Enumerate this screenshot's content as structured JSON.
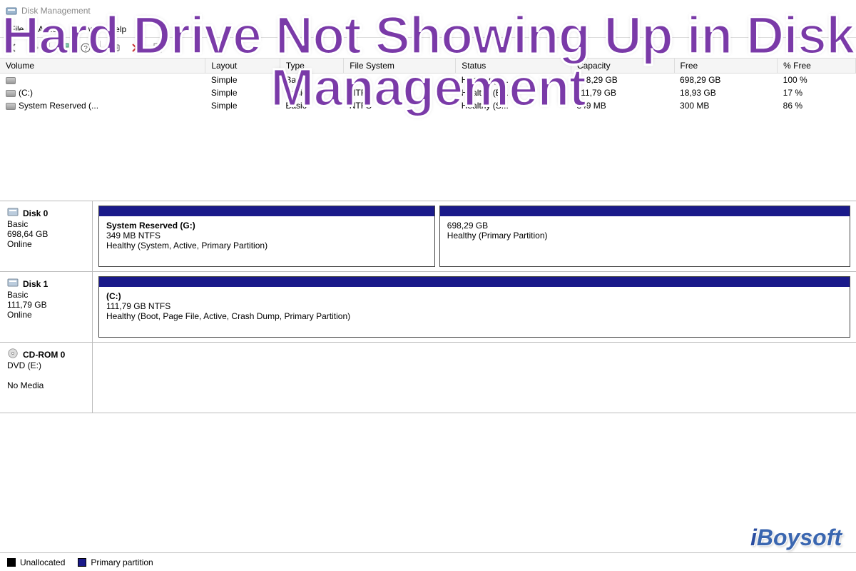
{
  "headline": "Hard Drive Not Showing Up in Disk Management",
  "watermark": "iBoysoft",
  "title": "Disk Management",
  "menu": {
    "file": "File",
    "action": "Action",
    "view": "View",
    "help": "Help"
  },
  "table": {
    "headers": {
      "volume": "Volume",
      "layout": "Layout",
      "type": "Type",
      "filesystem": "File System",
      "status": "Status",
      "capacity": "Capacity",
      "free": "Free",
      "pctfree": "% Free"
    },
    "rows": [
      {
        "volume": "",
        "layout": "Simple",
        "type": "Basic",
        "fs": "",
        "status": "Healthy (B...",
        "capacity": "698,29 GB",
        "free": "698,29 GB",
        "pct": "100 %"
      },
      {
        "volume": "(C:)",
        "layout": "Simple",
        "type": "Basic",
        "fs": "NTFS",
        "status": "Healthy (B...",
        "capacity": "111,79 GB",
        "free": "18,93 GB",
        "pct": "17 %"
      },
      {
        "volume": "System Reserved (...",
        "layout": "Simple",
        "type": "Basic",
        "fs": "NTFS",
        "status": "Healthy (S...",
        "capacity": "349 MB",
        "free": "300 MB",
        "pct": "86 %"
      }
    ]
  },
  "disks": [
    {
      "name": "Disk 0",
      "type": "Basic",
      "size": "698,64 GB",
      "status": "Online",
      "partitions": [
        {
          "title": "System Reserved  (G:)",
          "line2": "349 MB NTFS",
          "line3": "Healthy (System, Active, Primary Partition)",
          "flex": 0.45
        },
        {
          "title": "",
          "line2": "698,29 GB",
          "line3": "Healthy (Primary Partition)",
          "flex": 0.55
        }
      ]
    },
    {
      "name": "Disk 1",
      "type": "Basic",
      "size": "111,79 GB",
      "status": "Online",
      "partitions": [
        {
          "title": "(C:)",
          "line2": "111,79 GB NTFS",
          "line3": "Healthy (Boot, Page File, Active, Crash Dump, Primary Partition)",
          "flex": 1
        }
      ]
    },
    {
      "name": "CD-ROM 0",
      "type": "DVD (E:)",
      "size": "",
      "status": "No Media",
      "partitions": [],
      "iscd": true
    }
  ],
  "legend": {
    "unalloc": "Unallocated",
    "primary": "Primary partition"
  }
}
